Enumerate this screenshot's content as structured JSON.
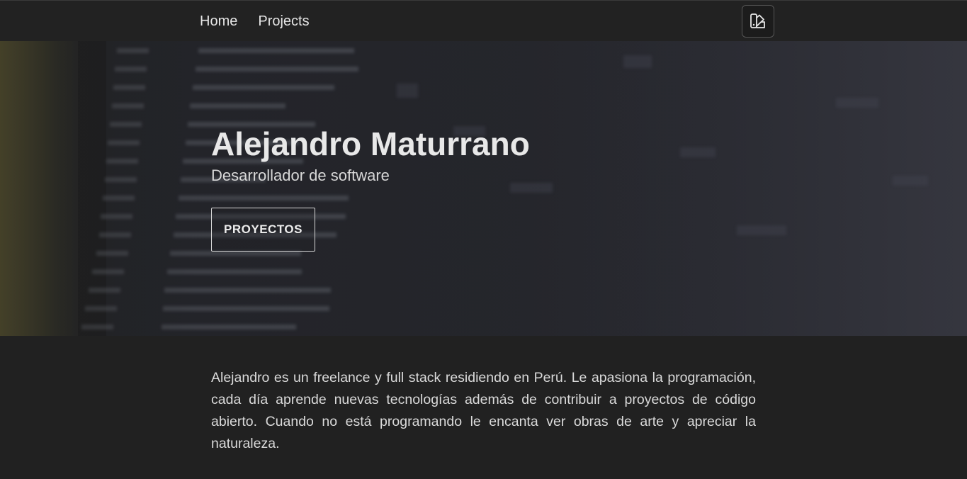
{
  "nav": {
    "items": [
      {
        "label": "Home"
      },
      {
        "label": "Projects"
      }
    ],
    "theme_button_icon": "palette-swatch-icon"
  },
  "hero": {
    "title": "Alejandro Maturrano",
    "subtitle": "Desarrollador de software",
    "button_label": "PROYECTOS",
    "background": "blurred-code-terminal-image"
  },
  "about": {
    "text": "Alejandro es un freelance y full stack residiendo en Perú. Le apasiona la programación, cada día aprende nuevas tecnologías además de contribuir a proyectos de código abierto. Cuando no está programando le encanta ver obras de arte y apreciar la naturaleza."
  },
  "colors": {
    "page_background": "#212121",
    "header_background": "#222222",
    "text": "#e6e6e6"
  }
}
